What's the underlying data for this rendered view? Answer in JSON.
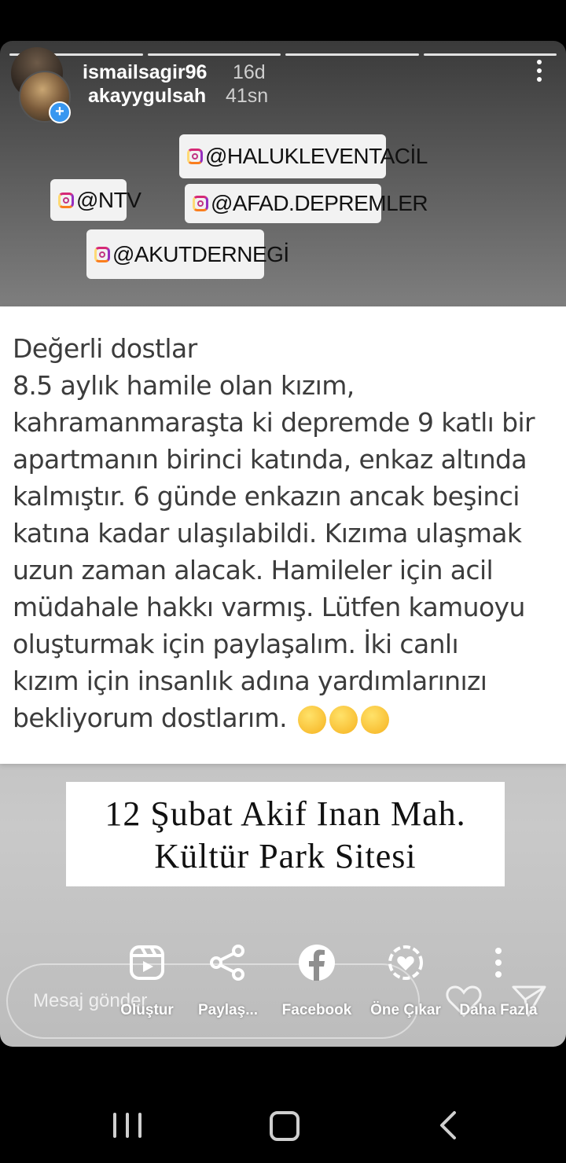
{
  "story": {
    "progress_segments": 4,
    "users": [
      {
        "name": "ismailsagir96",
        "time": "16d"
      },
      {
        "name": "akayygulsah",
        "time": "41sn"
      }
    ]
  },
  "mentions": [
    "@HALUKLEVENTACİL",
    "@NTV",
    "@AFAD.DEPREMLER",
    "@AKUTDERNEGİ"
  ],
  "note": {
    "lines": [
      "Değerli dostlar",
      "8.5 aylık hamile olan kızım,",
      "kahramanmaraşta ki depremde 9 katlı bir",
      "apartmanın birinci katında, enkaz altında",
      "kalmıştır. 6 günde enkazın ancak beşinci",
      "katına kadar ulaşılabildi. Kızıma ulaşmak",
      "uzun zaman alacak. Hamileler için acil",
      "müdahale hakkı varmış. Lütfen kamuoyu",
      "oluşturmak için paylaşalım. İki canlı",
      "kızım için insanlık adına yardımlarınızı",
      "bekliyorum dostlarım."
    ],
    "emoji": "sleepy-face-emoji"
  },
  "caption": {
    "line1": "12 Şubat Akif Inan Mah.",
    "line2": "Kültür Park Sitesi"
  },
  "message_placeholder": "Mesaj gönder",
  "actions": [
    {
      "label": "Oluştur",
      "icon": "reels-create-icon"
    },
    {
      "label": "Paylaş...",
      "icon": "share-icon"
    },
    {
      "label": "Facebook",
      "icon": "facebook-icon"
    },
    {
      "label": "Öne Çıkar",
      "icon": "highlight-icon"
    },
    {
      "label": "Daha Fazla",
      "icon": "more-icon"
    }
  ],
  "colors": {
    "plus_badge": "#3897f0",
    "background": "#000000"
  }
}
